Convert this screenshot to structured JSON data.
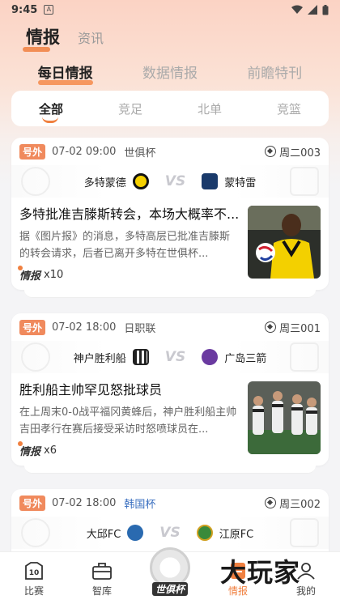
{
  "status": {
    "time": "9:45",
    "notif_letter": "A"
  },
  "top_tabs": [
    {
      "label": "情报"
    },
    {
      "label": "资讯"
    }
  ],
  "sub_tabs": [
    {
      "label": "每日情报"
    },
    {
      "label": "数据情报"
    },
    {
      "label": "前瞻特刊"
    }
  ],
  "filters": [
    {
      "label": "全部"
    },
    {
      "label": "竞足"
    },
    {
      "label": "北单"
    },
    {
      "label": "竞篮"
    }
  ],
  "cards": [
    {
      "badge": "号外",
      "time": "07-02 09:00",
      "league": "世俱杯",
      "code": "周二003",
      "home": "多特蒙德",
      "away": "蒙特雷",
      "title": "多特批准吉滕斯转会，本场大概率不...",
      "desc": "据《图片报》的消息，多特高层已批准吉滕斯的转会请求，后者已离开多特在世俱杯...",
      "tag": "情报",
      "count": "x10",
      "colors": {
        "home": "#f5d000",
        "away": "#1a3a6b"
      }
    },
    {
      "badge": "号外",
      "time": "07-02 18:00",
      "league": "日职联",
      "code": "周三001",
      "home": "神户胜利船",
      "away": "广岛三箭",
      "title": "胜利船主帅罕见怒批球员",
      "desc": "在上周末0-0战平福冈黄蜂后，神户胜利船主帅吉田孝行在赛后接受采访时怒喷球员在...",
      "tag": "情报",
      "count": "x6",
      "colors": {
        "home": "#222222",
        "away": "#6a3aa0"
      }
    },
    {
      "badge": "号外",
      "time": "07-02 18:00",
      "league": "韩国杯",
      "code": "周三002",
      "home": "大邱FC",
      "away": "江原FC",
      "colors": {
        "home": "#2a6ab0",
        "away": "#3a8a3a"
      }
    }
  ],
  "nav": [
    {
      "label": "比赛",
      "icon": "jersey-icon"
    },
    {
      "label": "智库",
      "icon": "toolbox-icon"
    },
    {
      "label": "世俱杯",
      "icon": "club-world-cup-logo"
    },
    {
      "label": "情报",
      "icon": "intel-icon"
    },
    {
      "label": "我的",
      "icon": "profile-icon"
    }
  ],
  "watermark": "大玩家"
}
